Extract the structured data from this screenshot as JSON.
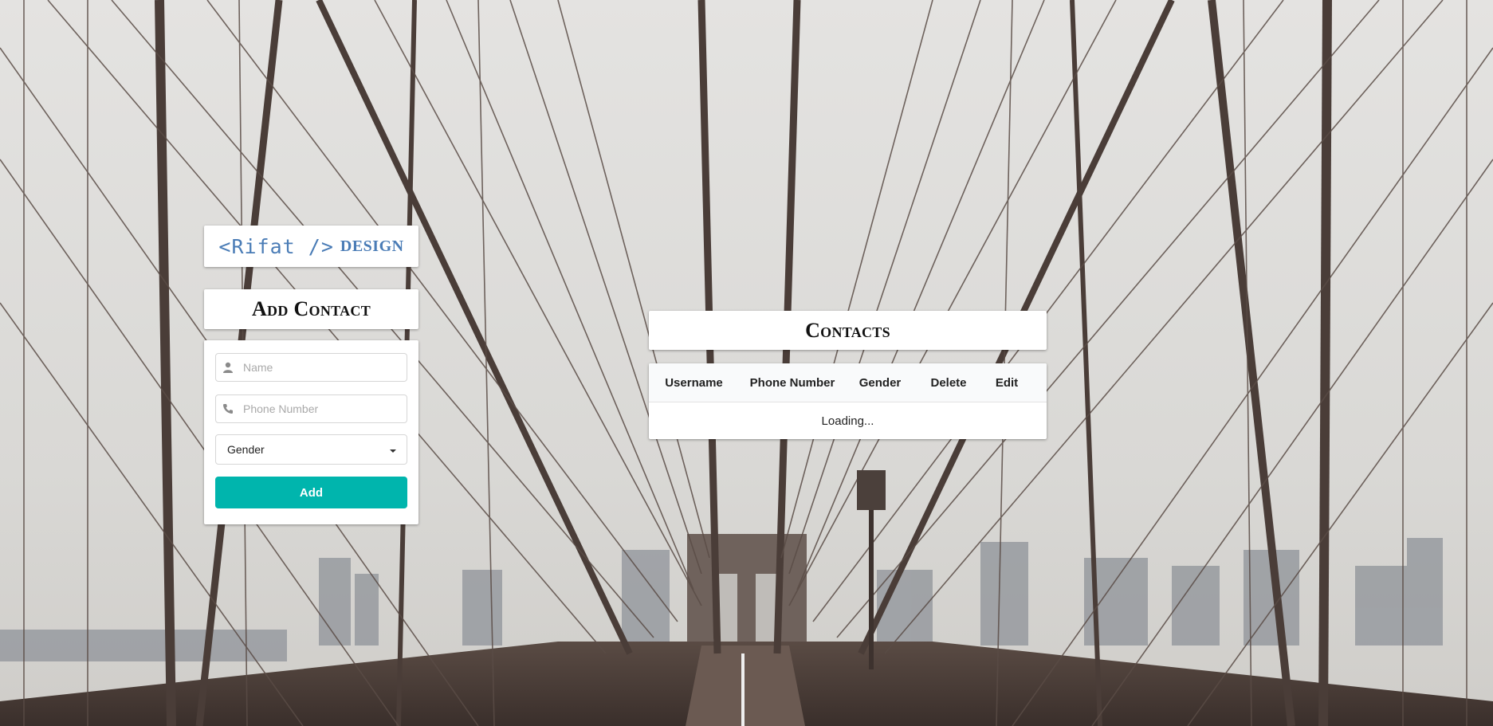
{
  "logo": {
    "code": "<Rifat />",
    "word": "DESIGN"
  },
  "add_contact": {
    "title": "Add Contact",
    "name_placeholder": "Name",
    "phone_placeholder": "Phone Number",
    "gender_select": {
      "selected": "Gender"
    },
    "add_label": "Add",
    "accent": "#00b5ad",
    "icons": {
      "name": "user-icon",
      "phone": "phone-icon",
      "select": "caret-down-icon"
    }
  },
  "contacts": {
    "title": "Contacts",
    "columns": [
      "Username",
      "Phone Number",
      "Gender",
      "Delete",
      "Edit"
    ],
    "status": "Loading..."
  }
}
